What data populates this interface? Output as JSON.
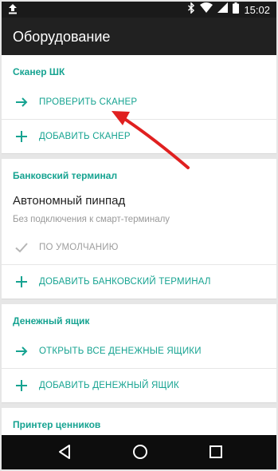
{
  "status_bar": {
    "time": "15:02",
    "icons": [
      "upload-icon",
      "bluetooth-icon",
      "wifi-icon",
      "signal-icon",
      "battery-icon"
    ]
  },
  "app_bar": {
    "title": "Оборудование"
  },
  "sections": {
    "scanner": {
      "header": "Сканер ШК",
      "check_label": "ПРОВЕРИТЬ СКАНЕР",
      "add_label": "ДОБАВИТЬ СКАНЕР"
    },
    "bank_terminal": {
      "header": "Банковский терминал",
      "device_name": "Автономный пинпад",
      "device_desc": "Без подключения к смарт-терминалу",
      "default_label": "ПО УМОЛЧАНИЮ",
      "add_label": "ДОБАВИТЬ БАНКОВСКИЙ ТЕРМИНАЛ"
    },
    "cash_drawer": {
      "header": "Денежный ящик",
      "open_label": "ОТКРЫТЬ ВСЕ ДЕНЕЖНЫЕ ЯЩИКИ",
      "add_label": "ДОБАВИТЬ ДЕНЕЖНЫЙ ЯЩИК"
    },
    "price_printer": {
      "header": "Принтер ценников"
    }
  },
  "colors": {
    "accent": "#16a391",
    "annotation_arrow": "#e02020",
    "app_bar": "#212121",
    "status_bar": "#1a1a1a",
    "nav_bar": "#0d0d0d"
  }
}
